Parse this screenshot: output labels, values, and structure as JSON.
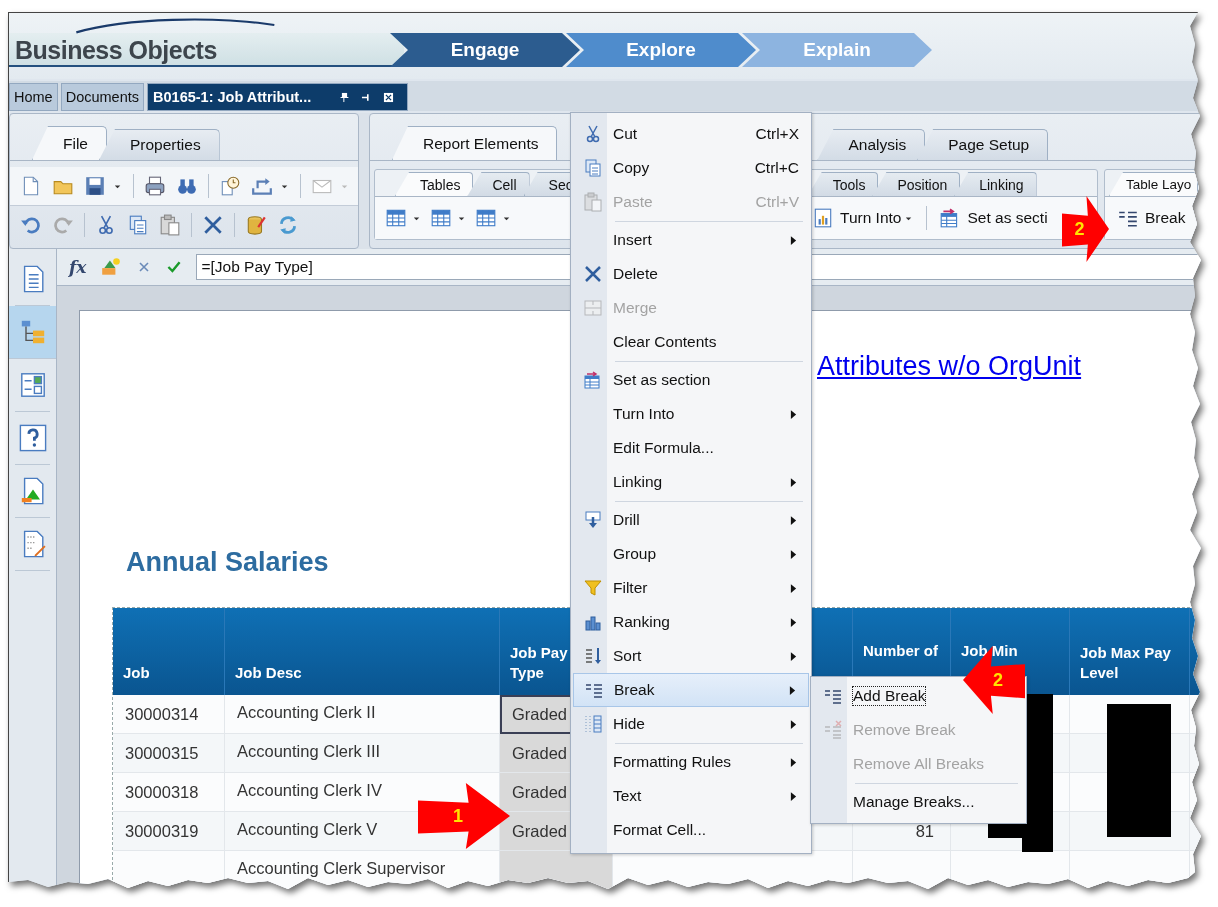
{
  "header": {
    "logo": "Business Objects",
    "steps": [
      {
        "label": "Engage"
      },
      {
        "label": "Explore"
      },
      {
        "label": "Explain"
      }
    ]
  },
  "document_tabs": [
    {
      "label": "Home",
      "selected": false
    },
    {
      "label": "Documents",
      "selected": false
    },
    {
      "label": "B0165-1: Job Attribut...",
      "selected": true
    }
  ],
  "ribbon": {
    "left": {
      "tabs": [
        {
          "label": "File",
          "selected": true
        },
        {
          "label": "Properties",
          "selected": false
        }
      ]
    },
    "right": {
      "tabs": [
        {
          "label": "Report Elements",
          "selected": true
        },
        {
          "label": "Analysis",
          "selected": false
        },
        {
          "label": "Page Setup",
          "selected": false
        }
      ],
      "subtabs": [
        {
          "label": "Tables",
          "selected": true
        },
        {
          "label": "Cell",
          "selected": false
        },
        {
          "label": "Sec",
          "selected": false
        },
        {
          "label": "Tools",
          "selected": false
        },
        {
          "label": "Position",
          "selected": false
        },
        {
          "label": "Linking",
          "selected": false
        }
      ],
      "buttons": [
        {
          "label": "Turn Into"
        },
        {
          "label": "Set as secti"
        }
      ],
      "layout_group": {
        "tab": "Table Layo",
        "button": "Break"
      }
    }
  },
  "formula_bar": {
    "fx": "fx",
    "value": "=[Job Pay Type]"
  },
  "report": {
    "title": "Attributes w/o OrgUnit",
    "section_title": "Annual Salaries",
    "table": {
      "columns": [
        {
          "label": "Job",
          "kind": "full"
        },
        {
          "label": "Job Desc",
          "kind": "full"
        },
        {
          "label": "Job Pay Type",
          "kind": "full"
        },
        {
          "kind": "blank"
        },
        {
          "label": "Number of",
          "kind": "partial"
        },
        {
          "label": "Job Min",
          "kind": "partial"
        },
        {
          "label": "Job Max Pay Level",
          "kind": "full"
        },
        {
          "kind": "blank"
        }
      ],
      "rows": [
        {
          "job": "30000314",
          "desc": "Accounting Clerk II",
          "pay_type": "Graded",
          "cell_selected": true
        },
        {
          "job": "30000315",
          "desc": "Accounting Clerk III",
          "pay_type": "Graded",
          "cell_selected": false
        },
        {
          "job": "30000318",
          "desc": "Accounting Clerk IV",
          "pay_type": "Graded",
          "cell_selected": false
        },
        {
          "job": "30000319",
          "desc": "Accounting Clerk V",
          "pay_type": "Graded",
          "positions": "81",
          "cell_selected": false
        },
        {
          "desc": "Accounting Clerk Supervisor",
          "cell_selected": false
        }
      ]
    }
  },
  "context_menu": {
    "groups": [
      [
        {
          "label": "Cut",
          "shortcut": "Ctrl+X",
          "disabled": false,
          "has_submenu": false,
          "selected": false
        },
        {
          "label": "Copy",
          "shortcut": "Ctrl+C",
          "disabled": false,
          "has_submenu": false,
          "selected": false
        },
        {
          "label": "Paste",
          "shortcut": "Ctrl+V",
          "disabled": true,
          "has_submenu": false,
          "selected": false
        }
      ],
      [
        {
          "label": "Insert",
          "disabled": false,
          "has_submenu": true,
          "selected": false
        },
        {
          "label": "Delete",
          "disabled": false,
          "has_submenu": false,
          "selected": false
        },
        {
          "label": "Merge",
          "disabled": true,
          "has_submenu": false,
          "selected": false
        },
        {
          "label": "Clear Contents",
          "disabled": false,
          "has_submenu": false,
          "selected": false
        }
      ],
      [
        {
          "label": "Set as section",
          "disabled": false,
          "has_submenu": false,
          "selected": false
        },
        {
          "label": "Turn Into",
          "disabled": false,
          "has_submenu": true,
          "selected": false
        },
        {
          "label": "Edit Formula...",
          "disabled": false,
          "has_submenu": false,
          "selected": false
        },
        {
          "label": "Linking",
          "disabled": false,
          "has_submenu": true,
          "selected": false
        }
      ],
      [
        {
          "label": "Drill",
          "disabled": false,
          "has_submenu": true,
          "selected": false
        },
        {
          "label": "Group",
          "disabled": false,
          "has_submenu": true,
          "selected": false
        },
        {
          "label": "Filter",
          "disabled": false,
          "has_submenu": true,
          "selected": false
        },
        {
          "label": "Ranking",
          "disabled": false,
          "has_submenu": true,
          "selected": false
        },
        {
          "label": "Sort",
          "disabled": false,
          "has_submenu": true,
          "selected": false
        },
        {
          "label": "Break",
          "disabled": false,
          "has_submenu": true,
          "selected": true
        },
        {
          "label": "Hide",
          "disabled": false,
          "has_submenu": true,
          "selected": false
        }
      ],
      [
        {
          "label": "Formatting Rules",
          "disabled": false,
          "has_submenu": true,
          "selected": false
        },
        {
          "label": "Text",
          "disabled": false,
          "has_submenu": true,
          "selected": false
        },
        {
          "label": "Format Cell...",
          "disabled": false,
          "has_submenu": false,
          "selected": false
        }
      ]
    ]
  },
  "submenu": {
    "groups": [
      [
        {
          "label": "Add Break",
          "disabled": false,
          "selected": true
        },
        {
          "label": "Remove Break",
          "disabled": true,
          "selected": false
        },
        {
          "label": "Remove All Breaks",
          "disabled": true,
          "selected": false
        }
      ],
      [
        {
          "label": "Manage Breaks...",
          "disabled": false,
          "selected": false
        }
      ]
    ]
  },
  "callouts": [
    {
      "number": "1"
    },
    {
      "number": "2"
    },
    {
      "number": "2"
    }
  ]
}
